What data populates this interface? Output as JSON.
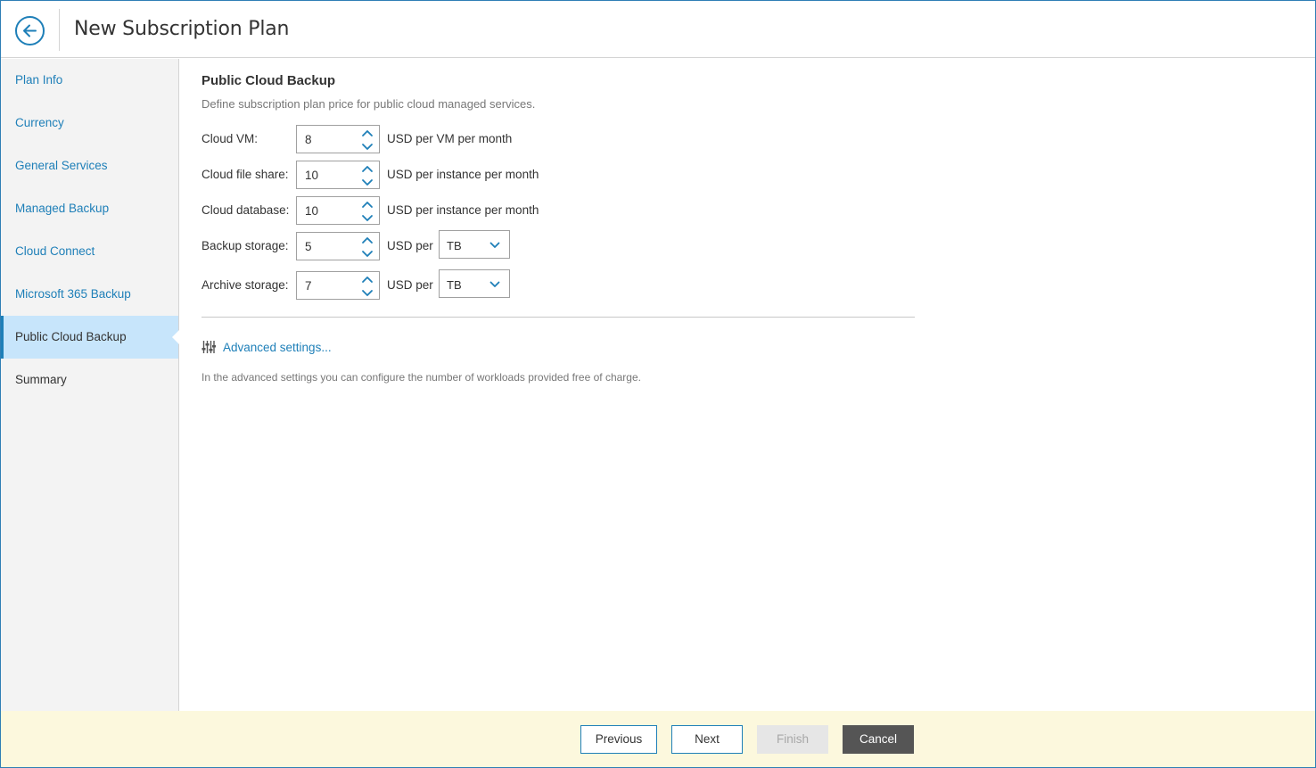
{
  "header": {
    "title": "New Subscription Plan"
  },
  "sidebar": {
    "items": [
      {
        "label": "Plan Info"
      },
      {
        "label": "Currency"
      },
      {
        "label": "General Services"
      },
      {
        "label": "Managed Backup"
      },
      {
        "label": "Cloud Connect"
      },
      {
        "label": "Microsoft 365 Backup"
      },
      {
        "label": "Public Cloud Backup"
      },
      {
        "label": "Summary"
      }
    ],
    "active_index": 6
  },
  "main": {
    "title": "Public Cloud Backup",
    "description": "Define subscription plan price for public cloud managed services.",
    "fields": [
      {
        "label": "Cloud VM:",
        "value": "8",
        "unit": "USD per VM per month"
      },
      {
        "label": "Cloud file share:",
        "value": "10",
        "unit": "USD per instance per month"
      },
      {
        "label": "Cloud database:",
        "value": "10",
        "unit": "USD per instance per month"
      },
      {
        "label": "Backup storage:",
        "value": "5",
        "unit": "USD per",
        "select": "TB"
      },
      {
        "label": "Archive storage:",
        "value": "7",
        "unit": "USD per",
        "select": "TB"
      }
    ],
    "advanced_link": "Advanced settings...",
    "advanced_note": "In the advanced settings you can configure the number of workloads provided free of charge."
  },
  "footer": {
    "previous": "Previous",
    "next": "Next",
    "finish": "Finish",
    "cancel": "Cancel"
  },
  "colors": {
    "accent": "#1e7fb8",
    "active_nav_bg": "#c7e5fb",
    "footer_bg": "#fcf8dd",
    "cancel_bg": "#555555"
  },
  "icons": {
    "back": "arrow-left-circle-icon",
    "spinner": "chevron-up-down-icon",
    "select": "chevron-down-icon",
    "advanced": "sliders-icon"
  }
}
